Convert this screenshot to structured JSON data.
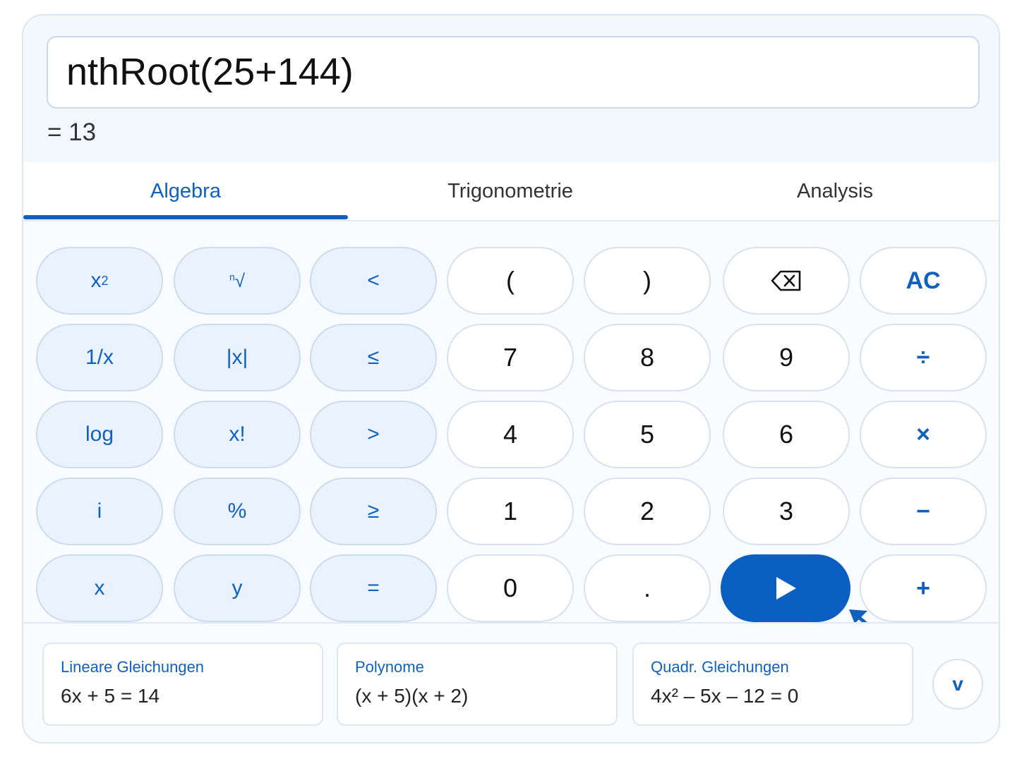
{
  "display": {
    "input": "nthRoot(25+144)",
    "result": "= 13"
  },
  "tabs": [
    {
      "label": "Algebra",
      "active": true
    },
    {
      "label": "Trigonometrie",
      "active": false
    },
    {
      "label": "Analysis",
      "active": false
    }
  ],
  "keys": {
    "x_squared": {
      "base": "x",
      "sup": "2"
    },
    "nth_root": {
      "index": "n",
      "radical": "√"
    },
    "less": "<",
    "paren_open": "(",
    "paren_close": ")",
    "backspace_icon": "backspace-icon",
    "all_clear": "AC",
    "reciprocal": "1/x",
    "abs": "|x|",
    "less_equal": "≤",
    "seven": "7",
    "eight": "8",
    "nine": "9",
    "divide": "÷",
    "log": "log",
    "factorial": "x!",
    "greater": ">",
    "four": "4",
    "five": "5",
    "six": "6",
    "multiply": "×",
    "imaginary": "i",
    "percent": "%",
    "greater_equal": "≥",
    "one": "1",
    "two": "2",
    "three": "3",
    "minus": "−",
    "var_x": "x",
    "var_y": "y",
    "equals": "=",
    "zero": "0",
    "decimal": ".",
    "enter_icon": "play-icon",
    "plus": "+"
  },
  "examples": [
    {
      "title": "Lineare Gleichungen",
      "expr": "6x + 5 = 14"
    },
    {
      "title": "Polynome",
      "expr": "(x + 5)(x + 2)"
    },
    {
      "title": "Quadr. Gleichungen",
      "expr": "4x² – 5x – 12 = 0"
    }
  ],
  "more_label": "v",
  "colors": {
    "accent": "#1060c0",
    "enter_button": "#0a5fc0",
    "function_key_bg": "#eaf3fd",
    "panel_bg": "#f8fbff"
  }
}
